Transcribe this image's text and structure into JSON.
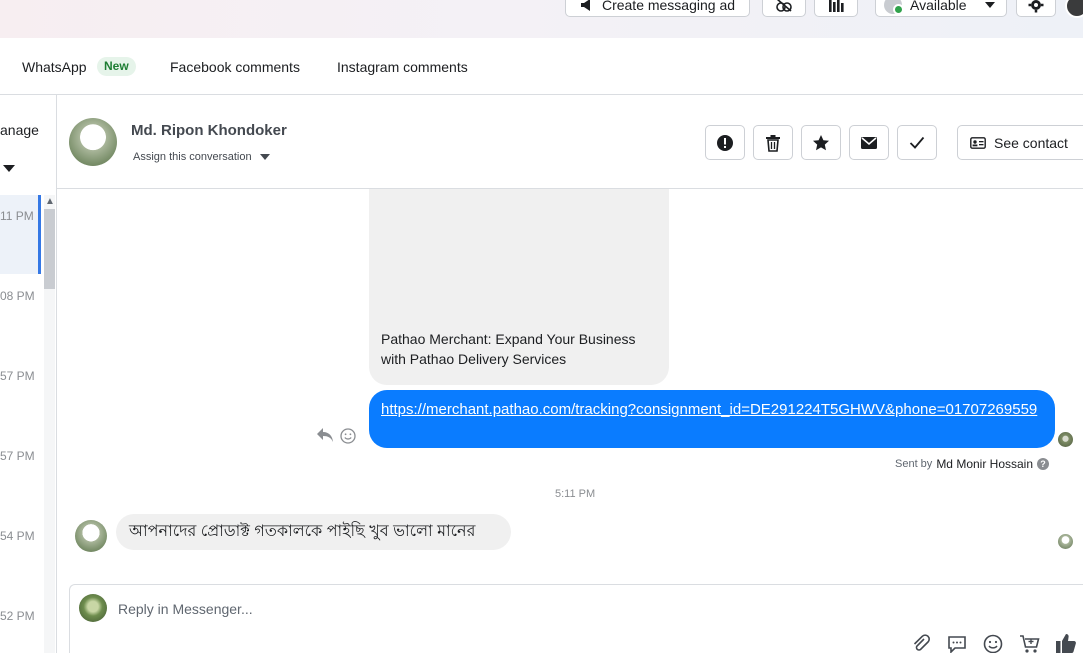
{
  "topbar": {
    "create_ad_label": "Create messaging ad",
    "status_label": "Available"
  },
  "tabs": [
    {
      "label": "WhatsApp",
      "badge": "New"
    },
    {
      "label": "Facebook comments"
    },
    {
      "label": "Instagram comments"
    }
  ],
  "left": {
    "manage_label": "anage",
    "times": [
      "11 PM",
      "08 PM",
      "57 PM",
      "57 PM",
      "54 PM",
      "52 PM"
    ]
  },
  "contact": {
    "name": "Md. Ripon Khondoker",
    "assign_label": "Assign this conversation",
    "see_contact_label": "See contact"
  },
  "messages": {
    "link_card_title": "Pathao Merchant: Expand Your Business with Pathao Delivery Services",
    "outgoing_link": "https://merchant.pathao.com/tracking?consignment_id=DE291224T5GHWV&phone=01707269559",
    "sent_by_prefix": "Sent by",
    "sent_by_name": "Md Monir Hossain",
    "timestamp": "5:11 PM",
    "incoming_text": "আপনাদের প্রোডাক্ট গতকালকে পাইছি খুব ভালো মানের"
  },
  "composer": {
    "placeholder": "Reply in Messenger..."
  },
  "colors": {
    "accent": "#0a7cff",
    "selected_bar": "#3578e5",
    "available_dot": "#31a24c"
  }
}
